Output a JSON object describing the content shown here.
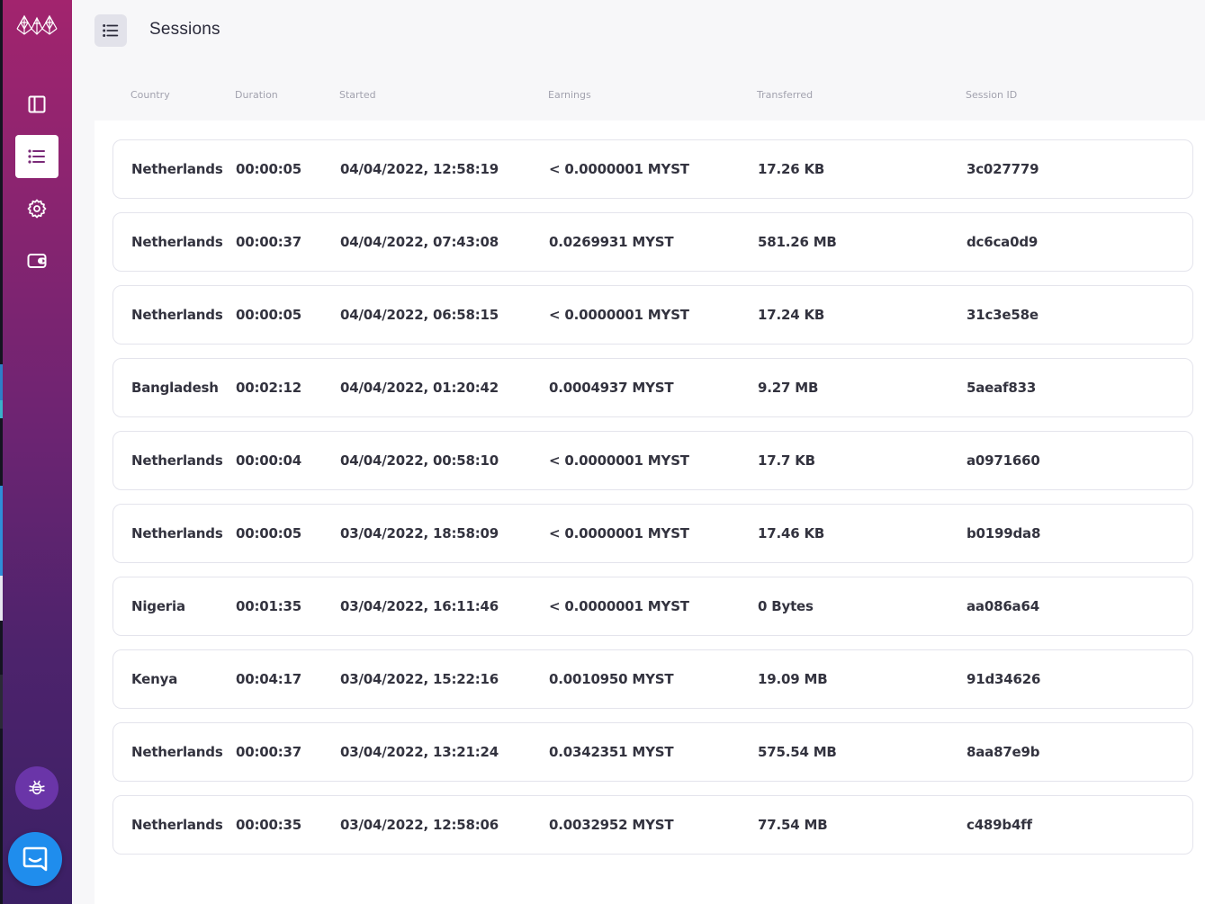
{
  "page": {
    "title": "Sessions"
  },
  "sidebar": {
    "items": [
      {
        "name": "dashboard",
        "icon": "sidebar-panel-icon",
        "active": false
      },
      {
        "name": "sessions",
        "icon": "list-icon",
        "active": true
      },
      {
        "name": "settings",
        "icon": "gear-icon",
        "active": false
      },
      {
        "name": "wallet",
        "icon": "wallet-icon",
        "active": false
      }
    ],
    "bug_icon": "bug-icon",
    "chat_icon": "chat-icon"
  },
  "colors": {
    "sidebar_top": "#a2246e",
    "sidebar_bottom": "#3b2065",
    "bug_button": "#6a35a8",
    "chat_button": "#1f8ded",
    "header_button": "#e2e2ea"
  },
  "table": {
    "headers": [
      "Country",
      "Duration",
      "Started",
      "Earnings",
      "Transferred",
      "Session ID"
    ],
    "rows": [
      [
        "Netherlands",
        "00:00:05",
        "04/04/2022, 12:58:19",
        "< 0.0000001 MYST",
        "17.26 KB",
        "3c027779"
      ],
      [
        "Netherlands",
        "00:00:37",
        "04/04/2022, 07:43:08",
        "0.0269931 MYST",
        "581.26 MB",
        "dc6ca0d9"
      ],
      [
        "Netherlands",
        "00:00:05",
        "04/04/2022, 06:58:15",
        "< 0.0000001 MYST",
        "17.24 KB",
        "31c3e58e"
      ],
      [
        "Bangladesh",
        "00:02:12",
        "04/04/2022, 01:20:42",
        "0.0004937 MYST",
        "9.27 MB",
        "5aeaf833"
      ],
      [
        "Netherlands",
        "00:00:04",
        "04/04/2022, 00:58:10",
        "< 0.0000001 MYST",
        "17.7 KB",
        "a0971660"
      ],
      [
        "Netherlands",
        "00:00:05",
        "03/04/2022, 18:58:09",
        "< 0.0000001 MYST",
        "17.46 KB",
        "b0199da8"
      ],
      [
        "Nigeria",
        "00:01:35",
        "03/04/2022, 16:11:46",
        "< 0.0000001 MYST",
        "0 Bytes",
        "aa086a64"
      ],
      [
        "Kenya",
        "00:04:17",
        "03/04/2022, 15:22:16",
        "0.0010950 MYST",
        "19.09 MB",
        "91d34626"
      ],
      [
        "Netherlands",
        "00:00:37",
        "03/04/2022, 13:21:24",
        "0.0342351 MYST",
        "575.54 MB",
        "8aa87e9b"
      ],
      [
        "Netherlands",
        "00:00:35",
        "03/04/2022, 12:58:06",
        "0.0032952 MYST",
        "77.54 MB",
        "c489b4ff"
      ]
    ]
  }
}
